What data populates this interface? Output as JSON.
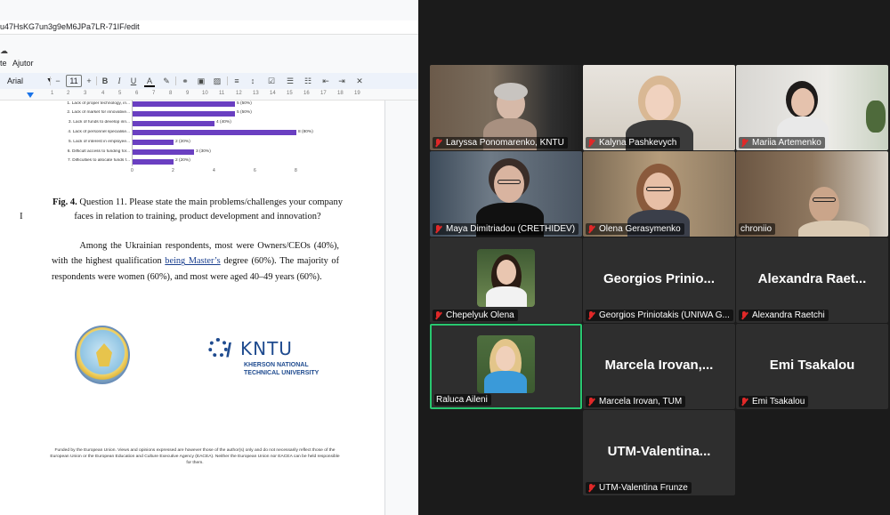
{
  "docs": {
    "url": "u47HsKG7un3g9eM6JPa7LR-71IF/edit",
    "menu": [
      "te",
      "Ajutor"
    ],
    "toolbar": {
      "font": "Arial",
      "font_size": "11",
      "minus": "−",
      "plus": "+"
    },
    "ruler_numbers": [
      "1",
      "2",
      "3",
      "4",
      "5",
      "6",
      "7",
      "8",
      "9",
      "10",
      "11",
      "12",
      "13",
      "14",
      "15",
      "16",
      "17",
      "18",
      "19"
    ],
    "chart_data": {
      "type": "bar",
      "orientation": "horizontal",
      "categories": [
        "1. Lack of proper technology, in...",
        "2. Lack of market for innovative...",
        "3. Lack of funds to develop inn...",
        "4. Lack of personnel specialise...",
        "5. Lack of interest in employee...",
        "6. Difficult access to funding for...",
        "7. Difficulties to allocate funds f..."
      ],
      "values": [
        5,
        5,
        4,
        8,
        2,
        3,
        2
      ],
      "value_labels": [
        "5 (50%)",
        "5 (50%)",
        "4 (40%)",
        "8 (80%)",
        "2 (20%)",
        "3 (30%)",
        "2 (20%)"
      ],
      "xticks": [
        "0",
        "2",
        "4",
        "6",
        "8"
      ],
      "xlim": [
        0,
        8
      ],
      "color": "#6a3fc1"
    },
    "caption_bold": "Fig. 4.",
    "caption_text": " Question 11. Please state the main problems/challenges your company faces in relation to training, product development and innovation?",
    "para_1": "Among the Ukrainian respondents, most were Owners/CEOs (40%), with the highest qualification ",
    "para_link": "being Master’s",
    "para_2": " degree (60%). The majority of respondents were women (60%), and most were aged 40–49 years (60%).",
    "kntu_logo": "KNTU",
    "kntu_sub": "KHERSON NATIONAL TECHNICAL UNIVERSITY",
    "footer": "Funded by the European Union. Views and opinions expressed are however those of the author(s) only and do not necessarily reflect those of the European Union or the European Education and Culture Executive Agency (EACEA). Neither the European Union nor EACEA can be held responsible for them."
  },
  "meeting": {
    "tiles": [
      {
        "name": "Laryssa Ponomarenko, KNTU"
      },
      {
        "name": "Kalyna Pashkevych"
      },
      {
        "name": "Mariia Artemenko"
      },
      {
        "name": "Maya Dimitriadou (CRETHIDEV)"
      },
      {
        "name": "Olena Gerasymenko"
      },
      {
        "name": "chroniio"
      },
      {
        "name": "Chepelyuk Olena"
      },
      {
        "name": "Georgios Priniotakis (UNIWA G...",
        "big": "Georgios Prinio..."
      },
      {
        "name": "Alexandra Raetchi",
        "big": "Alexandra Raet..."
      },
      {
        "name": "Raluca Aileni"
      },
      {
        "name": "Marcela Irovan, TUM",
        "big": "Marcela Irovan,..."
      },
      {
        "name": "Emi Tsakalou",
        "big": "Emi Tsakalou"
      },
      {
        "name": "UTM-Valentina Frunze",
        "big": "UTM-Valentina..."
      }
    ],
    "colors": {
      "active_border": "#28c76f",
      "muted_mic": "#e02828",
      "background": "#1b1b1b"
    }
  }
}
